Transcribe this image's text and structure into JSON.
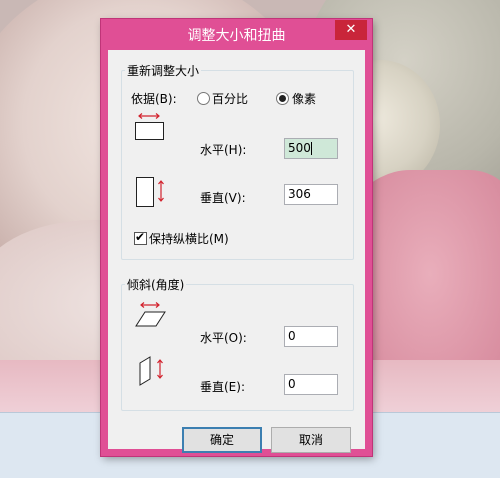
{
  "dialog": {
    "title": "调整大小和扭曲",
    "close_glyph": "✕",
    "resize": {
      "group_label": "重新调整大小",
      "by_label": "依据(B):",
      "percent_label": "百分比",
      "pixels_label": "像素",
      "selected": "pixels",
      "horizontal_label": "水平(H):",
      "horizontal_value": "500",
      "vertical_label": "垂直(V):",
      "vertical_value": "306",
      "keep_ratio_label": "保持纵横比(M)",
      "keep_ratio_checked": true
    },
    "skew": {
      "group_label": "倾斜(角度)",
      "horizontal_label": "水平(O):",
      "horizontal_value": "0",
      "vertical_label": "垂直(E):",
      "vertical_value": "0"
    },
    "ok_label": "确定",
    "cancel_label": "取消"
  },
  "colors": {
    "title_bar": "#e04f95",
    "close_button": "#c9253a",
    "arrow_red": "#d2222d"
  },
  "icons": [
    "resize-horizontal-icon",
    "resize-vertical-icon",
    "skew-horizontal-icon",
    "skew-vertical-icon",
    "close-icon"
  ]
}
